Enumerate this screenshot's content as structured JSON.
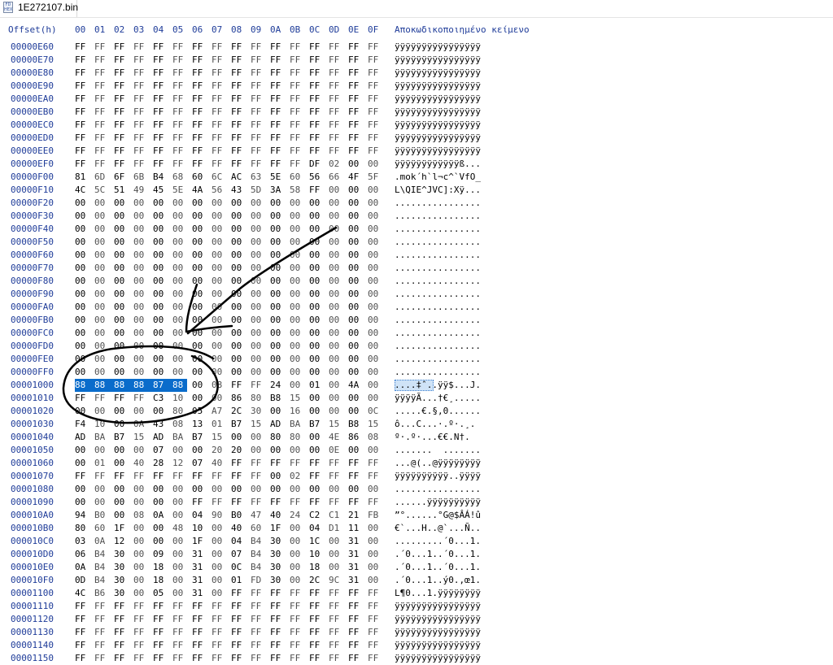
{
  "tab": {
    "title": "1E272107.bin",
    "icon": "hex-file-icon",
    "icon_text": "FD\nHEX"
  },
  "header": {
    "offset_label": "Offset(h)",
    "columns": [
      "00",
      "01",
      "02",
      "03",
      "04",
      "05",
      "06",
      "07",
      "08",
      "09",
      "0A",
      "0B",
      "0C",
      "0D",
      "0E",
      "0F"
    ],
    "decoded_label": "Αποκωδικοποιημένο κείμενο"
  },
  "selection": {
    "row": 26,
    "start": 0,
    "end": 5
  },
  "rows": [
    {
      "offset": "00000E60",
      "bytes": "FF FF FF FF FF FF FF FF FF FF FF FF FF FF FF FF",
      "text": "ÿÿÿÿÿÿÿÿÿÿÿÿÿÿÿÿ"
    },
    {
      "offset": "00000E70",
      "bytes": "FF FF FF FF FF FF FF FF FF FF FF FF FF FF FF FF",
      "text": "ÿÿÿÿÿÿÿÿÿÿÿÿÿÿÿÿ"
    },
    {
      "offset": "00000E80",
      "bytes": "FF FF FF FF FF FF FF FF FF FF FF FF FF FF FF FF",
      "text": "ÿÿÿÿÿÿÿÿÿÿÿÿÿÿÿÿ"
    },
    {
      "offset": "00000E90",
      "bytes": "FF FF FF FF FF FF FF FF FF FF FF FF FF FF FF FF",
      "text": "ÿÿÿÿÿÿÿÿÿÿÿÿÿÿÿÿ"
    },
    {
      "offset": "00000EA0",
      "bytes": "FF FF FF FF FF FF FF FF FF FF FF FF FF FF FF FF",
      "text": "ÿÿÿÿÿÿÿÿÿÿÿÿÿÿÿÿ"
    },
    {
      "offset": "00000EB0",
      "bytes": "FF FF FF FF FF FF FF FF FF FF FF FF FF FF FF FF",
      "text": "ÿÿÿÿÿÿÿÿÿÿÿÿÿÿÿÿ"
    },
    {
      "offset": "00000EC0",
      "bytes": "FF FF FF FF FF FF FF FF FF FF FF FF FF FF FF FF",
      "text": "ÿÿÿÿÿÿÿÿÿÿÿÿÿÿÿÿ"
    },
    {
      "offset": "00000ED0",
      "bytes": "FF FF FF FF FF FF FF FF FF FF FF FF FF FF FF FF",
      "text": "ÿÿÿÿÿÿÿÿÿÿÿÿÿÿÿÿ"
    },
    {
      "offset": "00000EE0",
      "bytes": "FF FF FF FF FF FF FF FF FF FF FF FF FF FF FF FF",
      "text": "ÿÿÿÿÿÿÿÿÿÿÿÿÿÿÿÿ"
    },
    {
      "offset": "00000EF0",
      "bytes": "FF FF FF FF FF FF FF FF FF FF FF FF DF 02 00 00",
      "text": "ÿÿÿÿÿÿÿÿÿÿÿÿß..."
    },
    {
      "offset": "00000F00",
      "bytes": "81 6D 6F 6B B4 68 60 6C AC 63 5E 60 56 66 4F 5F",
      "text": ".mok´h`l¬c^`VfO_"
    },
    {
      "offset": "00000F10",
      "bytes": "4C 5C 51 49 45 5E 4A 56 43 5D 3A 58 FF 00 00 00",
      "text": "L\\QIE^JVC]:Xÿ..."
    },
    {
      "offset": "00000F20",
      "bytes": "00 00 00 00 00 00 00 00 00 00 00 00 00 00 00 00",
      "text": "................"
    },
    {
      "offset": "00000F30",
      "bytes": "00 00 00 00 00 00 00 00 00 00 00 00 00 00 00 00",
      "text": "................"
    },
    {
      "offset": "00000F40",
      "bytes": "00 00 00 00 00 00 00 00 00 00 00 00 00 00 00 00",
      "text": "................"
    },
    {
      "offset": "00000F50",
      "bytes": "00 00 00 00 00 00 00 00 00 00 00 00 00 00 00 00",
      "text": "................"
    },
    {
      "offset": "00000F60",
      "bytes": "00 00 00 00 00 00 00 00 00 00 00 00 00 00 00 00",
      "text": "................"
    },
    {
      "offset": "00000F70",
      "bytes": "00 00 00 00 00 00 00 00 00 00 00 00 00 00 00 00",
      "text": "................"
    },
    {
      "offset": "00000F80",
      "bytes": "00 00 00 00 00 00 00 00 00 00 00 00 00 00 00 00",
      "text": "................"
    },
    {
      "offset": "00000F90",
      "bytes": "00 00 00 00 00 00 00 00 00 00 00 00 00 00 00 00",
      "text": "................"
    },
    {
      "offset": "00000FA0",
      "bytes": "00 00 00 00 00 00 00 00 00 00 00 00 00 00 00 00",
      "text": "................"
    },
    {
      "offset": "00000FB0",
      "bytes": "00 00 00 00 00 00 00 00 00 00 00 00 00 00 00 00",
      "text": "................"
    },
    {
      "offset": "00000FC0",
      "bytes": "00 00 00 00 00 00 00 00 00 00 00 00 00 00 00 00",
      "text": "................"
    },
    {
      "offset": "00000FD0",
      "bytes": "00 00 00 00 00 00 00 00 00 00 00 00 00 00 00 00",
      "text": "................"
    },
    {
      "offset": "00000FE0",
      "bytes": "00 00 00 00 00 00 00 00 00 00 00 00 00 00 00 00",
      "text": "................"
    },
    {
      "offset": "00000FF0",
      "bytes": "00 00 00 00 00 00 00 00 00 00 00 00 00 00 00 00",
      "text": "................"
    },
    {
      "offset": "00001000",
      "bytes": "88 88 88 88 87 88 00 08 FF FF 24 00 01 00 4A 00",
      "text": "....‡ˆ..ÿÿ$...J."
    },
    {
      "offset": "00001010",
      "bytes": "FF FF FF FF C3 10 00 00 86 80 B8 15 00 00 00 00",
      "text": "ÿÿÿÿÃ...†€¸....."
    },
    {
      "offset": "00001020",
      "bytes": "00 00 00 00 00 80 05 A7 2C 30 00 16 00 00 00 0C",
      "text": ".....€.§,0......"
    },
    {
      "offset": "00001030",
      "bytes": "F4 10 00 0A 43 08 13 01 B7 15 AD BA B7 15 B8 15",
      "text": "ô...C...·.­º·.¸."
    },
    {
      "offset": "00001040",
      "bytes": "AD BA B7 15 AD BA B7 15 00 00 80 80 00 4E 86 08",
      "text": "­º·.­º·...€€.N†."
    },
    {
      "offset": "00001050",
      "bytes": "00 00 00 00 07 00 00 20 20 00 00 00 00 0E 00 00",
      "text": ".......  ......."
    },
    {
      "offset": "00001060",
      "bytes": "00 01 00 40 28 12 07 40 FF FF FF FF FF FF FF FF",
      "text": "...@(..@ÿÿÿÿÿÿÿÿ"
    },
    {
      "offset": "00001070",
      "bytes": "FF FF FF FF FF FF FF FF FF FF 00 02 FF FF FF FF",
      "text": "ÿÿÿÿÿÿÿÿÿÿ..ÿÿÿÿ"
    },
    {
      "offset": "00001080",
      "bytes": "00 00 00 00 00 00 00 00 00 00 00 00 00 00 00 00",
      "text": "................"
    },
    {
      "offset": "00001090",
      "bytes": "00 00 00 00 00 00 FF FF FF FF FF FF FF FF FF FF",
      "text": "......ÿÿÿÿÿÿÿÿÿÿ"
    },
    {
      "offset": "000010A0",
      "bytes": "94 B0 00 08 0A 00 04 90 B0 47 40 24 C2 C1 21 FB",
      "text": "”°......°G@$ÂÁ!û"
    },
    {
      "offset": "000010B0",
      "bytes": "80 60 1F 00 00 48 10 00 40 60 1F 00 04 D1 11 00",
      "text": "€`...H..@`...Ñ.."
    },
    {
      "offset": "000010C0",
      "bytes": "03 0A 12 00 00 00 1F 00 04 B4 30 00 1C 00 31 00",
      "text": ".........´0...1."
    },
    {
      "offset": "000010D0",
      "bytes": "06 B4 30 00 09 00 31 00 07 B4 30 00 10 00 31 00",
      "text": ".´0...1..´0...1."
    },
    {
      "offset": "000010E0",
      "bytes": "0A B4 30 00 18 00 31 00 0C B4 30 00 18 00 31 00",
      "text": ".´0...1..´0...1."
    },
    {
      "offset": "000010F0",
      "bytes": "0D B4 30 00 18 00 31 00 01 FD 30 00 2C 9C 31 00",
      "text": ".´0...1..ý0.,œ1."
    },
    {
      "offset": "00001100",
      "bytes": "4C B6 30 00 05 00 31 00 FF FF FF FF FF FF FF FF",
      "text": "L¶0...1.ÿÿÿÿÿÿÿÿ"
    },
    {
      "offset": "00001110",
      "bytes": "FF FF FF FF FF FF FF FF FF FF FF FF FF FF FF FF",
      "text": "ÿÿÿÿÿÿÿÿÿÿÿÿÿÿÿÿ"
    },
    {
      "offset": "00001120",
      "bytes": "FF FF FF FF FF FF FF FF FF FF FF FF FF FF FF FF",
      "text": "ÿÿÿÿÿÿÿÿÿÿÿÿÿÿÿÿ"
    },
    {
      "offset": "00001130",
      "bytes": "FF FF FF FF FF FF FF FF FF FF FF FF FF FF FF FF",
      "text": "ÿÿÿÿÿÿÿÿÿÿÿÿÿÿÿÿ"
    },
    {
      "offset": "00001140",
      "bytes": "FF FF FF FF FF FF FF FF FF FF FF FF FF FF FF FF",
      "text": "ÿÿÿÿÿÿÿÿÿÿÿÿÿÿÿÿ"
    },
    {
      "offset": "00001150",
      "bytes": "FF FF FF FF FF FF FF FF FF FF FF FF FF FF FF FF",
      "text": "ÿÿÿÿÿÿÿÿÿÿÿÿÿÿÿÿ"
    }
  ]
}
